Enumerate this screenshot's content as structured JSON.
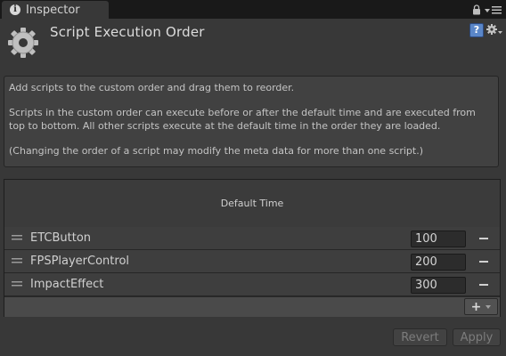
{
  "tab": {
    "label": "Inspector",
    "info_icon": "i"
  },
  "header": {
    "title": "Script Execution Order",
    "help_icon": "?"
  },
  "help": {
    "paragraphs": [
      "Add scripts to the custom order and drag them to reorder.",
      "Scripts in the custom order can execute before or after the default time and are executed from top to bottom. All other scripts execute at the default time in the order they are loaded.",
      "(Changing the order of a script may modify the meta data for more than one script.)"
    ]
  },
  "order_list": {
    "default_time_label": "Default Time",
    "rows": [
      {
        "name": "ETCButton",
        "order": "100"
      },
      {
        "name": "FPSPlayerControl",
        "order": "200"
      },
      {
        "name": "ImpactEffect",
        "order": "300"
      }
    ],
    "add_label": "+"
  },
  "buttons": {
    "revert": "Revert",
    "apply": "Apply"
  },
  "colors": {
    "background": "#383838",
    "tab_strip": "#191919",
    "help_badge": "#5a86c8",
    "disabled_text": "#7c7c7c"
  },
  "icons": [
    "info-icon",
    "lock-icon",
    "menu-icon",
    "gear-icon",
    "help-icon",
    "settings-icon",
    "drag-handle-icon",
    "minus-icon",
    "plus-icon",
    "caret-down-icon"
  ]
}
